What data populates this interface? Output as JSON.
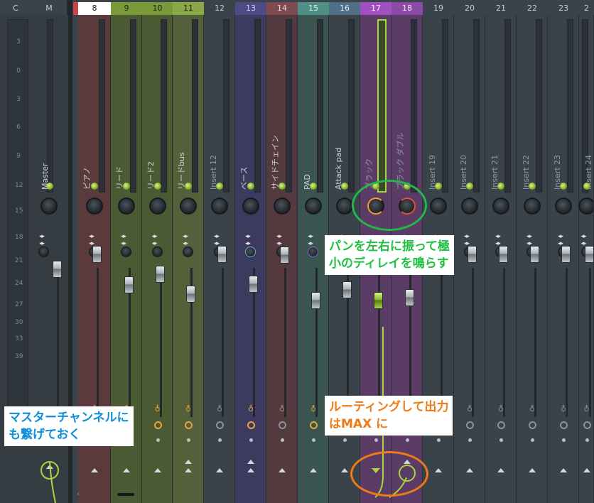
{
  "header": {
    "cells": [
      "C",
      "M",
      "8",
      "9",
      "10",
      "11",
      "12",
      "13",
      "14",
      "15",
      "16",
      "17",
      "18",
      "19",
      "20",
      "21",
      "22",
      "23",
      "2"
    ]
  },
  "scale_ticks": [
    "3",
    "0",
    "3",
    "6",
    "9",
    "12",
    "15",
    "18",
    "21",
    "24",
    "27",
    "30",
    "33",
    "39"
  ],
  "strips": [
    {
      "num": "8",
      "name": "ピアノ",
      "tint": "#5a3a3a",
      "hdr": "#ffffff",
      "hdr_text": "#222222"
    },
    {
      "num": "9",
      "name": "リード",
      "tint": "#4a5a32",
      "hdr": "#7a9a3a",
      "hdr_text": "#1c2410"
    },
    {
      "num": "10",
      "name": "リード2",
      "tint": "#4a5a32",
      "hdr": "#7a9a3a",
      "hdr_text": "#1c2410"
    },
    {
      "num": "11",
      "name": "リードbus",
      "tint": "#53603a",
      "hdr": "#8aa846",
      "hdr_text": "#1c2410"
    },
    {
      "num": "12",
      "name": "Insert 12",
      "tint": "#3b434a",
      "hdr": "#3b434a",
      "hdr_text": "#c8ced3",
      "dim": true
    },
    {
      "num": "13",
      "name": "ベース",
      "tint": "#3c3a5e",
      "hdr": "#4e4a86",
      "hdr_text": "#d6d4ee"
    },
    {
      "num": "14",
      "name": "サイドチェイン",
      "tint": "#543a3e",
      "hdr": "#7e4b50",
      "hdr_text": "#e8d6d8"
    },
    {
      "num": "15",
      "name": "PAD",
      "tint": "#3a5450",
      "hdr": "#4f8f86",
      "hdr_text": "#dcefec"
    },
    {
      "num": "16",
      "name": "Attack pad",
      "tint": "#3b434a",
      "hdr": "#4f6f86",
      "hdr_text": "#dbe6ee"
    },
    {
      "num": "17",
      "name": "ブラック",
      "tint": "#5b3c66",
      "hdr": "#a24fc2",
      "hdr_text": "#f7ecfb",
      "dim": true
    },
    {
      "num": "18",
      "name": "ブラック ダブル",
      "tint": "#5b3c66",
      "hdr": "#8a4aa6",
      "hdr_text": "#f2e6f7",
      "dim": true
    },
    {
      "num": "19",
      "name": "Insert 19",
      "tint": "#3b434a",
      "hdr": "#3b434a",
      "hdr_text": "#c8ced3",
      "dim": true
    },
    {
      "num": "20",
      "name": "Insert 20",
      "tint": "#3b434a",
      "hdr": "#3b434a",
      "hdr_text": "#c8ced3",
      "dim": true
    },
    {
      "num": "21",
      "name": "Insert 21",
      "tint": "#3b434a",
      "hdr": "#3b434a",
      "hdr_text": "#c8ced3",
      "dim": true
    },
    {
      "num": "22",
      "name": "Insert 22",
      "tint": "#3b434a",
      "hdr": "#3b434a",
      "hdr_text": "#c8ced3",
      "dim": true
    },
    {
      "num": "23",
      "name": "Insert 23",
      "tint": "#3b434a",
      "hdr": "#3b434a",
      "hdr_text": "#c8ced3",
      "dim": true
    },
    {
      "num": "2",
      "name": "Insert 24",
      "tint": "#3b434a",
      "hdr": "#3b434a",
      "hdr_text": "#c8ced3",
      "dim": true
    }
  ],
  "master": {
    "name": "Master"
  },
  "annotations": {
    "pan": [
      "パンを左右に振って極",
      "小のディレイを鳴らす"
    ],
    "master": [
      "マスターチャンネルに",
      "も繋げておく"
    ],
    "routing": [
      "ルーティングして出力",
      "はMAX に"
    ]
  },
  "colors": {
    "green_ring": "#22b84a",
    "orange_ring": "#f07a16",
    "route_line": "#a8d640"
  }
}
